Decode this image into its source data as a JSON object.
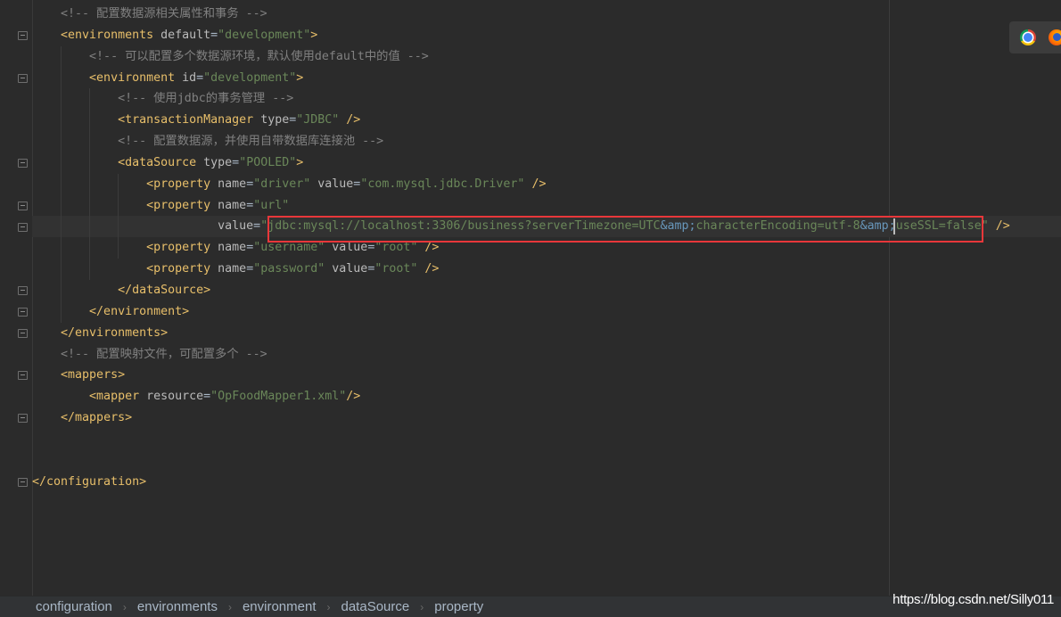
{
  "editor": {
    "current_line": 10,
    "lines": [
      {
        "indent": 1,
        "tokens": [
          [
            "com",
            "<!-- 配置数据源相关属性和事务 -->"
          ]
        ]
      },
      {
        "indent": 1,
        "fold": true,
        "tokens": [
          [
            "tag",
            "<environments"
          ],
          [
            "attr",
            " default"
          ],
          [
            "txt",
            "="
          ],
          [
            "str",
            "\"development\""
          ],
          [
            "tag",
            ">"
          ]
        ]
      },
      {
        "indent": 2,
        "tokens": [
          [
            "com",
            "<!-- 可以配置多个数据源环境，默认使用default中的值 -->"
          ]
        ]
      },
      {
        "indent": 2,
        "fold": true,
        "tokens": [
          [
            "tag",
            "<environment"
          ],
          [
            "attr",
            " id"
          ],
          [
            "txt",
            "="
          ],
          [
            "str",
            "\"development\""
          ],
          [
            "tag",
            ">"
          ]
        ]
      },
      {
        "indent": 3,
        "tokens": [
          [
            "com",
            "<!-- 使用jdbc的事务管理 -->"
          ]
        ]
      },
      {
        "indent": 3,
        "tokens": [
          [
            "tag",
            "<transactionManager"
          ],
          [
            "attr",
            " type"
          ],
          [
            "txt",
            "="
          ],
          [
            "str",
            "\"JDBC\""
          ],
          [
            "tag",
            " />"
          ]
        ]
      },
      {
        "indent": 3,
        "tokens": [
          [
            "com",
            "<!-- 配置数据源，并使用自带数据库连接池 -->"
          ]
        ]
      },
      {
        "indent": 3,
        "fold": true,
        "tokens": [
          [
            "tag",
            "<dataSource"
          ],
          [
            "attr",
            " type"
          ],
          [
            "txt",
            "="
          ],
          [
            "str",
            "\"POOLED\""
          ],
          [
            "tag",
            ">"
          ]
        ]
      },
      {
        "indent": 4,
        "tokens": [
          [
            "tag",
            "<property"
          ],
          [
            "attr",
            " name"
          ],
          [
            "txt",
            "="
          ],
          [
            "str",
            "\"driver\""
          ],
          [
            "attr",
            " value"
          ],
          [
            "txt",
            "="
          ],
          [
            "str",
            "\"com.mysql.jdbc.Driver\""
          ],
          [
            "tag",
            " />"
          ]
        ]
      },
      {
        "indent": 4,
        "fold": true,
        "tokens": [
          [
            "tag",
            "<property"
          ],
          [
            "attr",
            " name"
          ],
          [
            "txt",
            "="
          ],
          [
            "str",
            "\"url\""
          ]
        ]
      },
      {
        "indent": 0,
        "pad": 26,
        "fold": true,
        "tokens": [
          [
            "attr",
            "value"
          ],
          [
            "txt",
            "="
          ],
          [
            "str",
            "\"jdbc:mysql://localhost:3306/business?serverTimezone=UTC"
          ],
          [
            "ent",
            "&amp;"
          ],
          [
            "str",
            "characterEncoding=utf-8"
          ],
          [
            "ent",
            "&amp;"
          ],
          [
            "str",
            "useSSL=false\""
          ],
          [
            "tag",
            " />"
          ]
        ]
      },
      {
        "indent": 4,
        "tokens": [
          [
            "tag",
            "<property"
          ],
          [
            "attr",
            " name"
          ],
          [
            "txt",
            "="
          ],
          [
            "str",
            "\"username\""
          ],
          [
            "attr",
            " value"
          ],
          [
            "txt",
            "="
          ],
          [
            "str",
            "\"root\""
          ],
          [
            "tag",
            " />"
          ]
        ]
      },
      {
        "indent": 4,
        "tokens": [
          [
            "tag",
            "<property"
          ],
          [
            "attr",
            " name"
          ],
          [
            "txt",
            "="
          ],
          [
            "str",
            "\"password\""
          ],
          [
            "attr",
            " value"
          ],
          [
            "txt",
            "="
          ],
          [
            "str",
            "\"root\""
          ],
          [
            "tag",
            " />"
          ]
        ]
      },
      {
        "indent": 3,
        "fold": true,
        "tokens": [
          [
            "tag",
            "</dataSource>"
          ]
        ]
      },
      {
        "indent": 2,
        "fold": true,
        "tokens": [
          [
            "tag",
            "</environment>"
          ]
        ]
      },
      {
        "indent": 1,
        "fold": true,
        "tokens": [
          [
            "tag",
            "</environments>"
          ]
        ]
      },
      {
        "indent": 1,
        "tokens": [
          [
            "com",
            "<!-- 配置映射文件，可配置多个 -->"
          ]
        ]
      },
      {
        "indent": 1,
        "fold": true,
        "tokens": [
          [
            "tag",
            "<mappers>"
          ]
        ]
      },
      {
        "indent": 2,
        "tokens": [
          [
            "tag",
            "<mapper"
          ],
          [
            "attr",
            " resource"
          ],
          [
            "txt",
            "="
          ],
          [
            "str",
            "\"OpFoodMapper1.xml\""
          ],
          [
            "tag",
            "/>"
          ]
        ]
      },
      {
        "indent": 1,
        "fold": true,
        "tokens": [
          [
            "tag",
            "</mappers>"
          ]
        ]
      },
      {
        "indent": 0,
        "tokens": []
      },
      {
        "indent": 0,
        "tokens": []
      },
      {
        "indent": 0,
        "fold": true,
        "tokens": [
          [
            "tag",
            "</configuration>"
          ]
        ]
      }
    ]
  },
  "breadcrumb": [
    "configuration",
    "environments",
    "environment",
    "dataSource",
    "property"
  ],
  "watermark": "https://blog.csdn.net/Silly011",
  "browser_icons": [
    "chrome-icon",
    "firefox-icon"
  ],
  "colors": {
    "background": "#2b2b2b",
    "tag": "#e8bf6a",
    "attribute": "#bababa",
    "string": "#6a8759",
    "comment": "#808080",
    "entity": "#6897bb",
    "highlight_box": "#e8373a"
  }
}
